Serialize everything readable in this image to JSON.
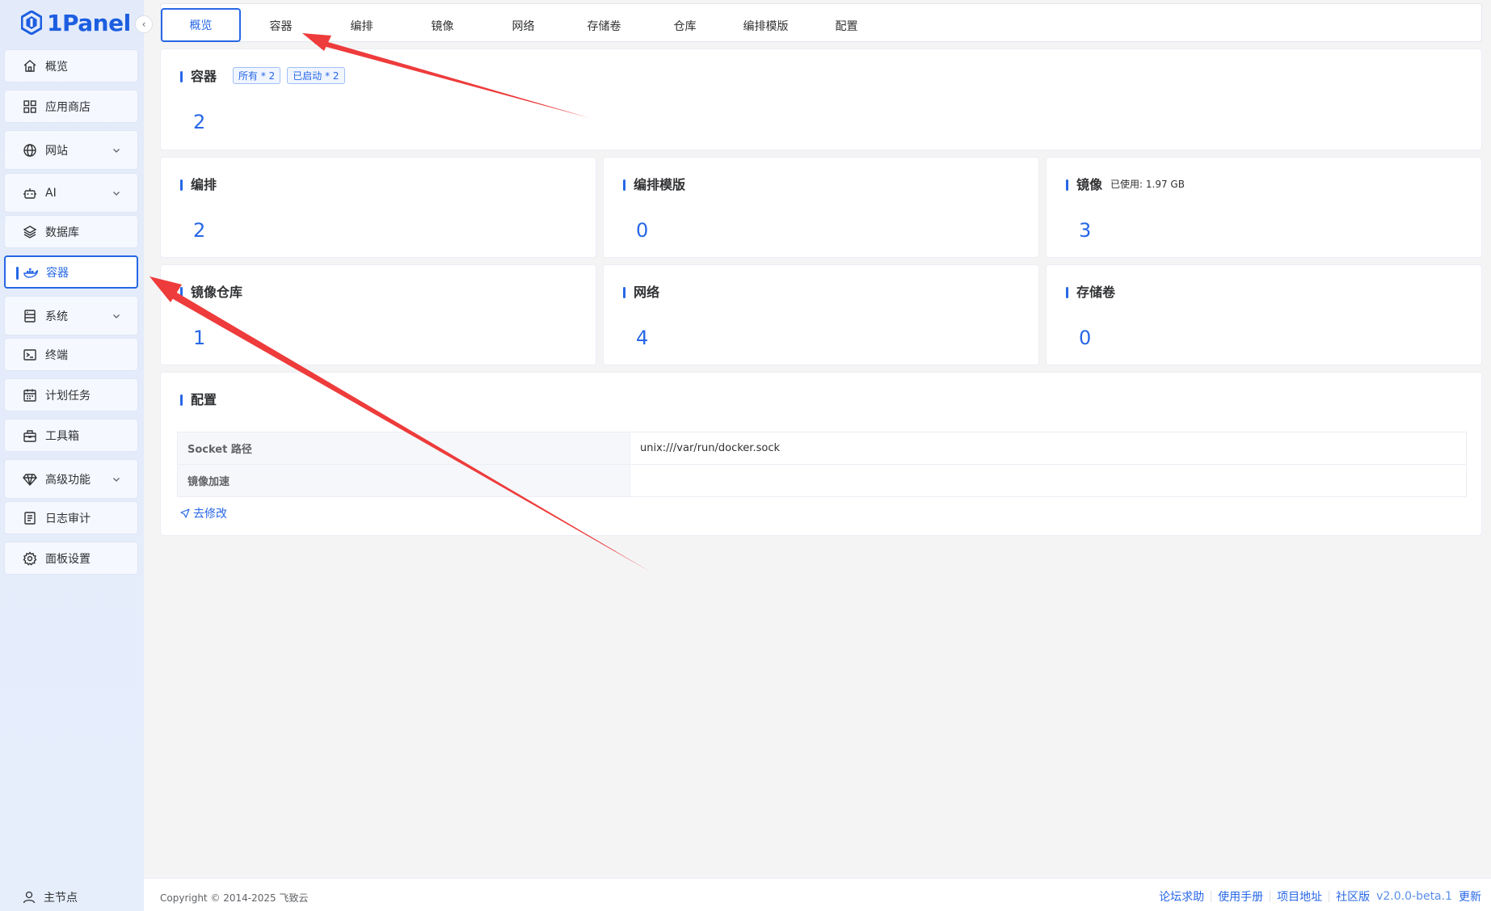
{
  "brand": {
    "name": "1Panel",
    "color": "#1d5ee0"
  },
  "sidebar": {
    "items": [
      {
        "label": "概览",
        "icon": "home-icon",
        "expandable": false,
        "active": false
      },
      {
        "label": "应用商店",
        "icon": "grid-icon",
        "expandable": false,
        "active": false
      },
      {
        "label": "网站",
        "icon": "globe-icon",
        "expandable": true,
        "active": false
      },
      {
        "label": "AI",
        "icon": "robot-icon",
        "expandable": true,
        "active": false
      },
      {
        "label": "数据库",
        "icon": "layers-icon",
        "expandable": false,
        "active": false
      },
      {
        "label": "容器",
        "icon": "docker-icon",
        "expandable": false,
        "active": true
      },
      {
        "label": "系统",
        "icon": "server-icon",
        "expandable": true,
        "active": false
      },
      {
        "label": "终端",
        "icon": "terminal-icon",
        "expandable": false,
        "active": false
      },
      {
        "label": "计划任务",
        "icon": "calendar-icon",
        "expandable": false,
        "active": false
      },
      {
        "label": "工具箱",
        "icon": "toolbox-icon",
        "expandable": false,
        "active": false
      },
      {
        "label": "高级功能",
        "icon": "diamond-icon",
        "expandable": true,
        "active": false
      },
      {
        "label": "日志审计",
        "icon": "log-icon",
        "expandable": false,
        "active": false
      },
      {
        "label": "面板设置",
        "icon": "gear-icon",
        "expandable": false,
        "active": false
      }
    ],
    "bottom_node": "主节点"
  },
  "tabs": [
    {
      "label": "概览",
      "active": true
    },
    {
      "label": "容器",
      "active": false
    },
    {
      "label": "编排",
      "active": false
    },
    {
      "label": "镜像",
      "active": false
    },
    {
      "label": "网络",
      "active": false
    },
    {
      "label": "存储卷",
      "active": false
    },
    {
      "label": "仓库",
      "active": false
    },
    {
      "label": "编排模版",
      "active": false
    },
    {
      "label": "配置",
      "active": false
    }
  ],
  "containers_card": {
    "title": "容器",
    "tag_all": "所有 * 2",
    "tag_running": "已启动 * 2",
    "count": "2"
  },
  "stats": {
    "compose": {
      "title": "编排",
      "count": "2"
    },
    "compose_template": {
      "title": "编排模版",
      "count": "0"
    },
    "image": {
      "title": "镜像",
      "note": "已使用: 1.97 GB",
      "count": "3"
    },
    "repo": {
      "title": "镜像仓库",
      "count": "1"
    },
    "network": {
      "title": "网络",
      "count": "4"
    },
    "volume": {
      "title": "存储卷",
      "count": "0"
    }
  },
  "config": {
    "title": "配置",
    "rows": [
      {
        "key": "Socket 路径",
        "value": "unix:///var/run/docker.sock"
      },
      {
        "key": "镜像加速",
        "value": ""
      }
    ],
    "edit_label": "去修改"
  },
  "footer": {
    "copyright": "Copyright © 2014-2025 飞致云",
    "links": [
      "论坛求助",
      "使用手册",
      "项目地址",
      "社区版"
    ],
    "version": "v2.0.0-beta.1",
    "update": "更新"
  },
  "colors": {
    "accent": "#2767e6",
    "annotation_arrow": "#ee3b3b"
  }
}
